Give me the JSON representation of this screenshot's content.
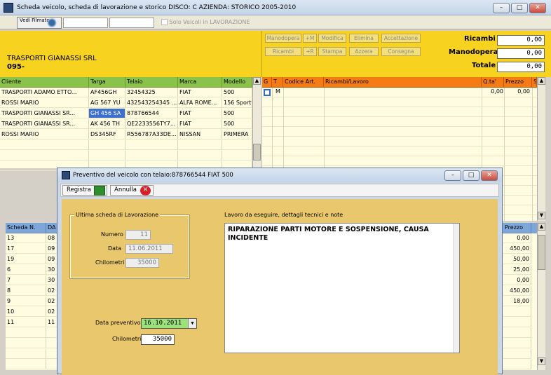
{
  "window": {
    "title": "Scheda veicolo, scheda di lavorazione e storico    DISCO: C    AZIENDA: STORICO 2005-2010"
  },
  "toolbar": {
    "vedi_filmato": "Vedi Filmato",
    "solo_lavorazione": "Solo Veicoli in LAVORAZIONE"
  },
  "company": {
    "name": "TRASPORTI GIANASSI SRL",
    "code": "095-"
  },
  "actions": {
    "row1": [
      "Manodopera",
      "+M",
      "Modifica",
      "Elimina",
      "Accettazione"
    ],
    "row2": [
      "Ricambi",
      "+R",
      "Stampa",
      "Azzera",
      "Consegna"
    ]
  },
  "totals": {
    "ricambi_label": "Ricambi",
    "ricambi": "0,00",
    "manodopera_label": "Manodopera",
    "manodopera": "0,00",
    "totale_label": "Totale",
    "totale": "0,00"
  },
  "vehicles": {
    "headers": [
      "Cliente",
      "Targa",
      "Telaio",
      "Marca",
      "Modello"
    ],
    "rows": [
      [
        "TRASPORTI ADAMO ETTO...",
        "AF456GH",
        "32454325",
        "FIAT",
        "500"
      ],
      [
        "ROSSI MARIO",
        "AG 567 YU",
        "432543254345 ...",
        "ALFA ROME...",
        "156 Sportw"
      ],
      [
        "TRASPORTI GIANASSI SR...",
        "GH 456 SA",
        "878766544",
        "FIAT",
        "500"
      ],
      [
        "TRASPORTI GIANASSI SR...",
        "AK 456 TH",
        "QE2233556TY7...",
        "FIAT",
        "500"
      ],
      [
        "ROSSI MARIO",
        "DS345RF",
        "R556787A33DE...",
        "NISSAN",
        "PRIMERA"
      ]
    ]
  },
  "parts": {
    "headers": [
      "G",
      "T",
      "Codice Art.",
      "Ricambi/Lavoro",
      "Q.ta'",
      "Prezzo",
      "S"
    ],
    "row": {
      "t": "M",
      "qta": "0,00",
      "prezzo": "0,00"
    }
  },
  "history": {
    "headers": [
      "Scheda N.",
      "DA"
    ],
    "price_header": "Prezzo",
    "rows": [
      [
        "13",
        "08"
      ],
      [
        "17",
        "09"
      ],
      [
        "19",
        "09"
      ],
      [
        "6",
        "30"
      ],
      [
        "7",
        "30"
      ],
      [
        "8",
        "02"
      ],
      [
        "9",
        "02"
      ],
      [
        "10",
        "02"
      ],
      [
        "11",
        "11"
      ]
    ],
    "prices": [
      "0,00",
      "450,00",
      "50,00",
      "25,00",
      "0,00",
      "450,00",
      "18,00"
    ]
  },
  "dialog": {
    "title": "Preventivo del veicolo con telaio:878766544 FIAT 500",
    "registra": "Registra",
    "annulla": "Annulla",
    "group_title": "Ultima scheda di Lavorazione",
    "numero_label": "Numero",
    "numero": "11",
    "data_label": "Data",
    "data": "11.06.2011",
    "chilometri_label": "Chilometri",
    "chilometri": "35000",
    "lavoro_label": "Lavoro da eseguire, dettagli tecnici e note",
    "lavoro": "RIPARAZIONE PARTI MOTORE E SOSPENSIONE, CAUSA INCIDENTE",
    "data_preventivo_label": "Data preventivo",
    "data_preventivo": "16.10.2011",
    "km_label": "Chilometri",
    "km": "35000"
  },
  "colors": {
    "yellow": "#f7d21e",
    "green_header": "#8bc34a",
    "orange_header": "#f57c14",
    "dialog_body": "#e9c86d"
  }
}
